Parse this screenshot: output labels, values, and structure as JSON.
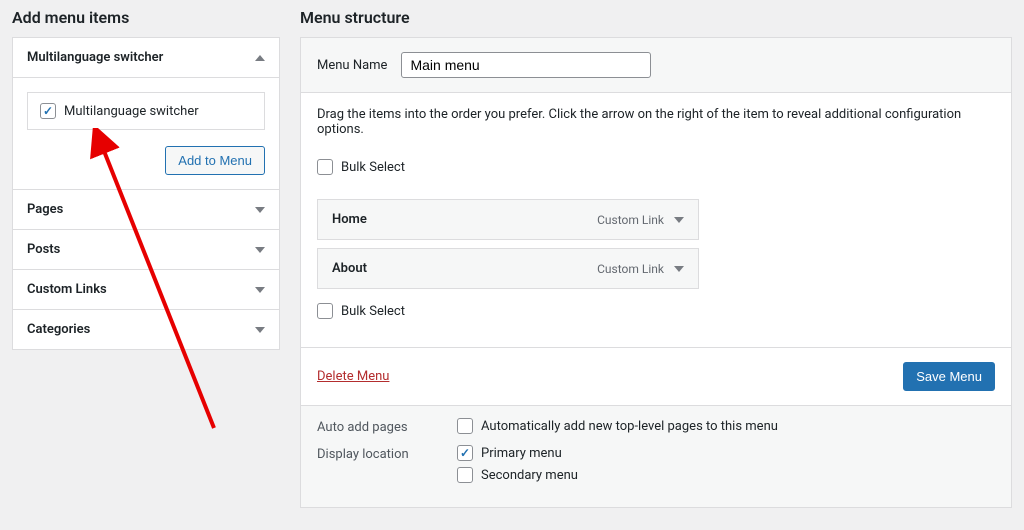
{
  "left": {
    "title": "Add menu items",
    "open_panel": {
      "header": "Multilanguage switcher",
      "checkbox_label": "Multilanguage switcher",
      "checkbox_checked": true,
      "add_button": "Add to Menu"
    },
    "collapsed_panels": [
      "Pages",
      "Posts",
      "Custom Links",
      "Categories"
    ]
  },
  "right": {
    "title": "Menu structure",
    "menu_name_label": "Menu Name",
    "menu_name_value": "Main menu",
    "instructions": "Drag the items into the order you prefer. Click the arrow on the right of the item to reveal additional configuration options.",
    "bulk_select_label": "Bulk Select",
    "menu_items": [
      {
        "title": "Home",
        "type": "Custom Link"
      },
      {
        "title": "About",
        "type": "Custom Link"
      }
    ],
    "delete_label": "Delete Menu",
    "save_label": "Save Menu",
    "settings": {
      "auto_add": {
        "label": "Auto add pages",
        "option": "Automatically add new top-level pages to this menu",
        "checked": false
      },
      "display_location": {
        "label": "Display location",
        "options": [
          {
            "label": "Primary menu",
            "checked": true
          },
          {
            "label": "Secondary menu",
            "checked": false
          }
        ]
      }
    }
  }
}
